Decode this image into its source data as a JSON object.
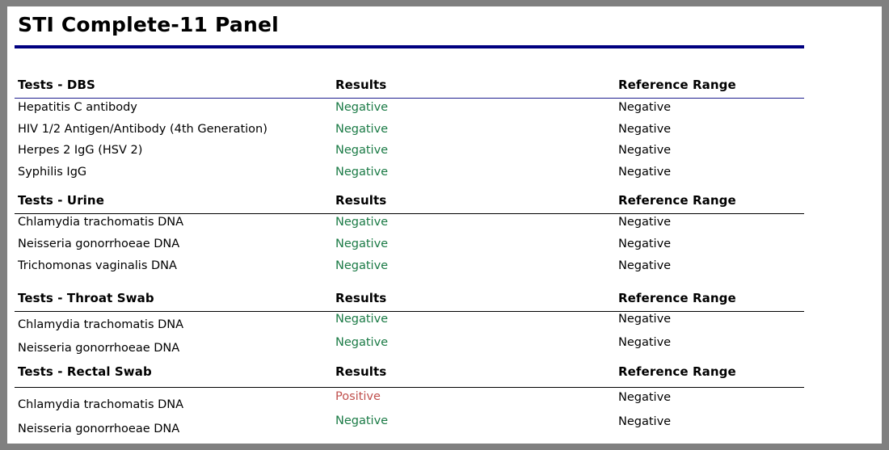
{
  "report": {
    "title": "STI Complete-11 Panel",
    "accent_rule_color": "#000080",
    "negative_color": "#1a7a45",
    "positive_color": "#c0504d",
    "page_border_color": "#808080"
  },
  "columns": {
    "results": "Results",
    "reference_range": "Reference Range"
  },
  "sections": [
    {
      "header": "Tests - DBS",
      "rows": [
        {
          "test": "Hepatitis C antibody",
          "result": "Negative",
          "reference": "Negative",
          "status": "negative"
        },
        {
          "test": "HIV 1/2 Antigen/Antibody (4th Generation)",
          "result": "Negative",
          "reference": "Negative",
          "status": "negative"
        },
        {
          "test": "Herpes 2 IgG (HSV 2)",
          "result": "Negative",
          "reference": "Negative",
          "status": "negative"
        },
        {
          "test": "Syphilis IgG",
          "result": "Negative",
          "reference": "Negative",
          "status": "negative"
        }
      ]
    },
    {
      "header": "Tests - Urine",
      "rows": [
        {
          "test": "Chlamydia trachomatis DNA",
          "result": "Negative",
          "reference": "Negative",
          "status": "negative"
        },
        {
          "test": "Neisseria gonorrhoeae DNA",
          "result": "Negative",
          "reference": "Negative",
          "status": "negative"
        },
        {
          "test": "Trichomonas vaginalis DNA",
          "result": "Negative",
          "reference": "Negative",
          "status": "negative"
        }
      ]
    },
    {
      "header": "Tests - Throat Swab",
      "rows": [
        {
          "test": "Chlamydia trachomatis DNA",
          "result": "Negative",
          "reference": "Negative",
          "status": "negative"
        },
        {
          "test": "Neisseria gonorrhoeae DNA",
          "result": "Negative",
          "reference": "Negative",
          "status": "negative"
        }
      ]
    },
    {
      "header": "Tests - Rectal Swab",
      "rows": [
        {
          "test": "Chlamydia trachomatis DNA",
          "result": "Positive",
          "reference": "Negative",
          "status": "positive"
        },
        {
          "test": "Neisseria gonorrhoeae DNA",
          "result": "Negative",
          "reference": "Negative",
          "status": "negative"
        }
      ]
    }
  ]
}
